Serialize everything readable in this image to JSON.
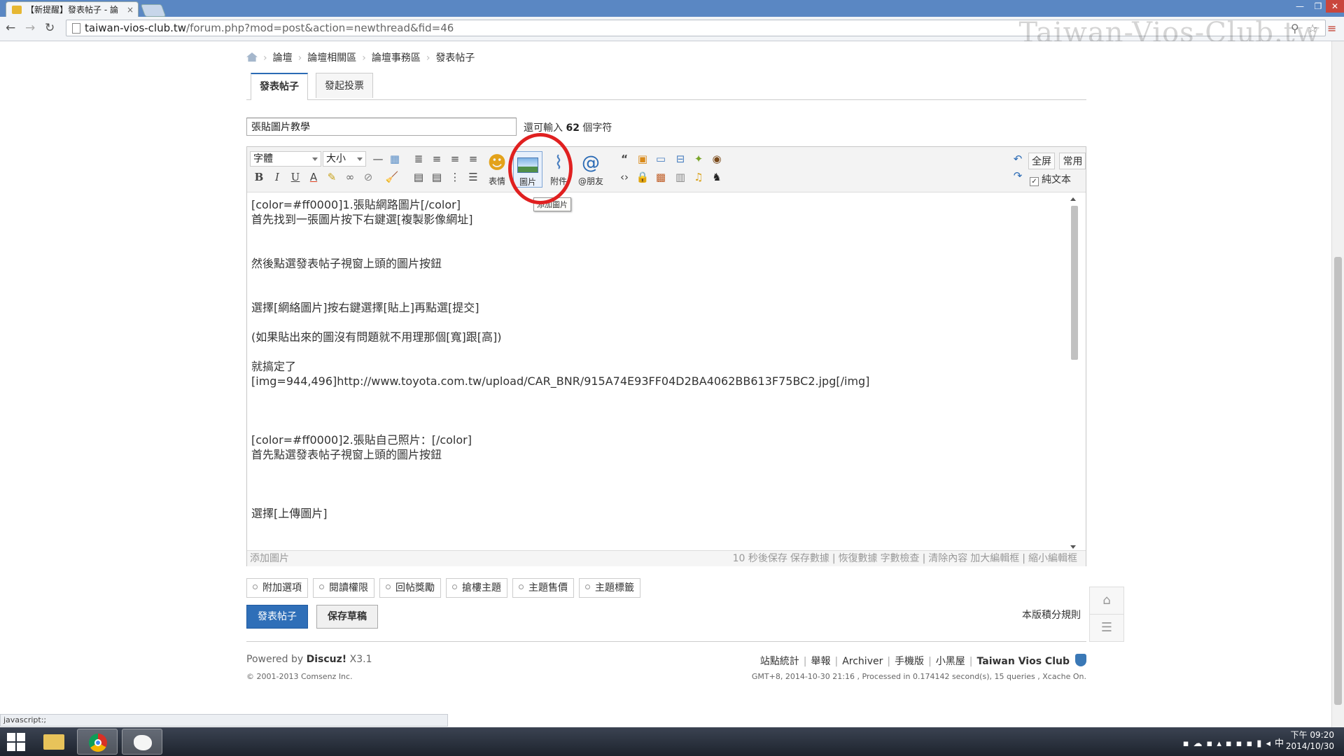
{
  "browser": {
    "tab_title": "【新提醒】發表帖子 - 論",
    "tab_close": "×",
    "url_host": "taiwan-vios-club.tw",
    "url_path": "/forum.php?mod=post&action=newthread&fid=46",
    "status_url": "javascript:;",
    "win_minimize": "—",
    "win_restore": "❐",
    "win_close": "✕"
  },
  "watermark": "Taiwan-Vios-Club.tw",
  "breadcrumb": [
    "論壇",
    "論壇相關區",
    "論壇事務區",
    "發表帖子"
  ],
  "post_tabs": [
    "發表帖子",
    "發起投票"
  ],
  "subject": {
    "value": "張貼圖片教學",
    "counter_prefix": "還可輸入",
    "counter_value": "62",
    "counter_suffix": "個字符"
  },
  "editor": {
    "font_select": "字體",
    "size_select": "大小",
    "format_buttons": [
      "B",
      "I",
      "U",
      "A"
    ],
    "emoticon_label": "表情",
    "image_label": "圖片",
    "attach_label": "附件",
    "friend_label": "@朋友",
    "tooltip": "添加圖片",
    "fullscreen": "全屏",
    "common": "常用",
    "plaintext": "純文本",
    "lines": [
      "[color=#ff0000]1.張貼網路圖片[/color]",
      "首先找到一張圖片按下右鍵選[複製影像網址]",
      "",
      "",
      "然後點選發表帖子視窗上頭的圖片按鈕",
      "",
      "",
      "選擇[網絡圖片]按右鍵選擇[貼上]再點選[提交]",
      "",
      "(如果貼出來的圖沒有問題就不用理那個[寬]跟[高])",
      "",
      "就搞定了",
      "[img=944,496]http://www.toyota.com.tw/upload/CAR_BNR/915A74E93FF04D2BA4062BB613F75BC2.jpg[/img]",
      "",
      "",
      "",
      "[color=#ff0000]2.張貼自己照片：[/color]",
      "首先點選發表帖子視窗上頭的圖片按鈕",
      "",
      "",
      "",
      "選擇[上傳圖片]"
    ],
    "status_left": "添加圖片",
    "status_right": [
      "10 秒後保存",
      "保存數據",
      "|",
      "恢復數據",
      "字數檢查",
      "|",
      "清除內容",
      "加大編輯框",
      "|",
      "縮小編輯框"
    ]
  },
  "options": [
    "附加選項",
    "閱讀權限",
    "回帖獎勵",
    "搶樓主題",
    "主題售價",
    "主題標籤"
  ],
  "buttons": {
    "publish": "發表帖子",
    "draft": "保存草稿"
  },
  "rules_link": "本版積分規則",
  "footer": {
    "powered_prefix": "Powered by",
    "powered_brand": "Discuz!",
    "powered_version": "X3.1",
    "copyright": "© 2001-2013 Comsenz Inc.",
    "links": [
      "站點統計",
      "舉報",
      "Archiver",
      "手機版",
      "小黑屋"
    ],
    "site_name": "Taiwan Vios Club",
    "stats": "GMT+8, 2014-10-30 21:16 , Processed in 0.174142 second(s), 15 queries , Xcache On."
  },
  "taskbar": {
    "time_line1": "下午 09:20",
    "time_line2": "2014/10/30",
    "ime": "中"
  }
}
